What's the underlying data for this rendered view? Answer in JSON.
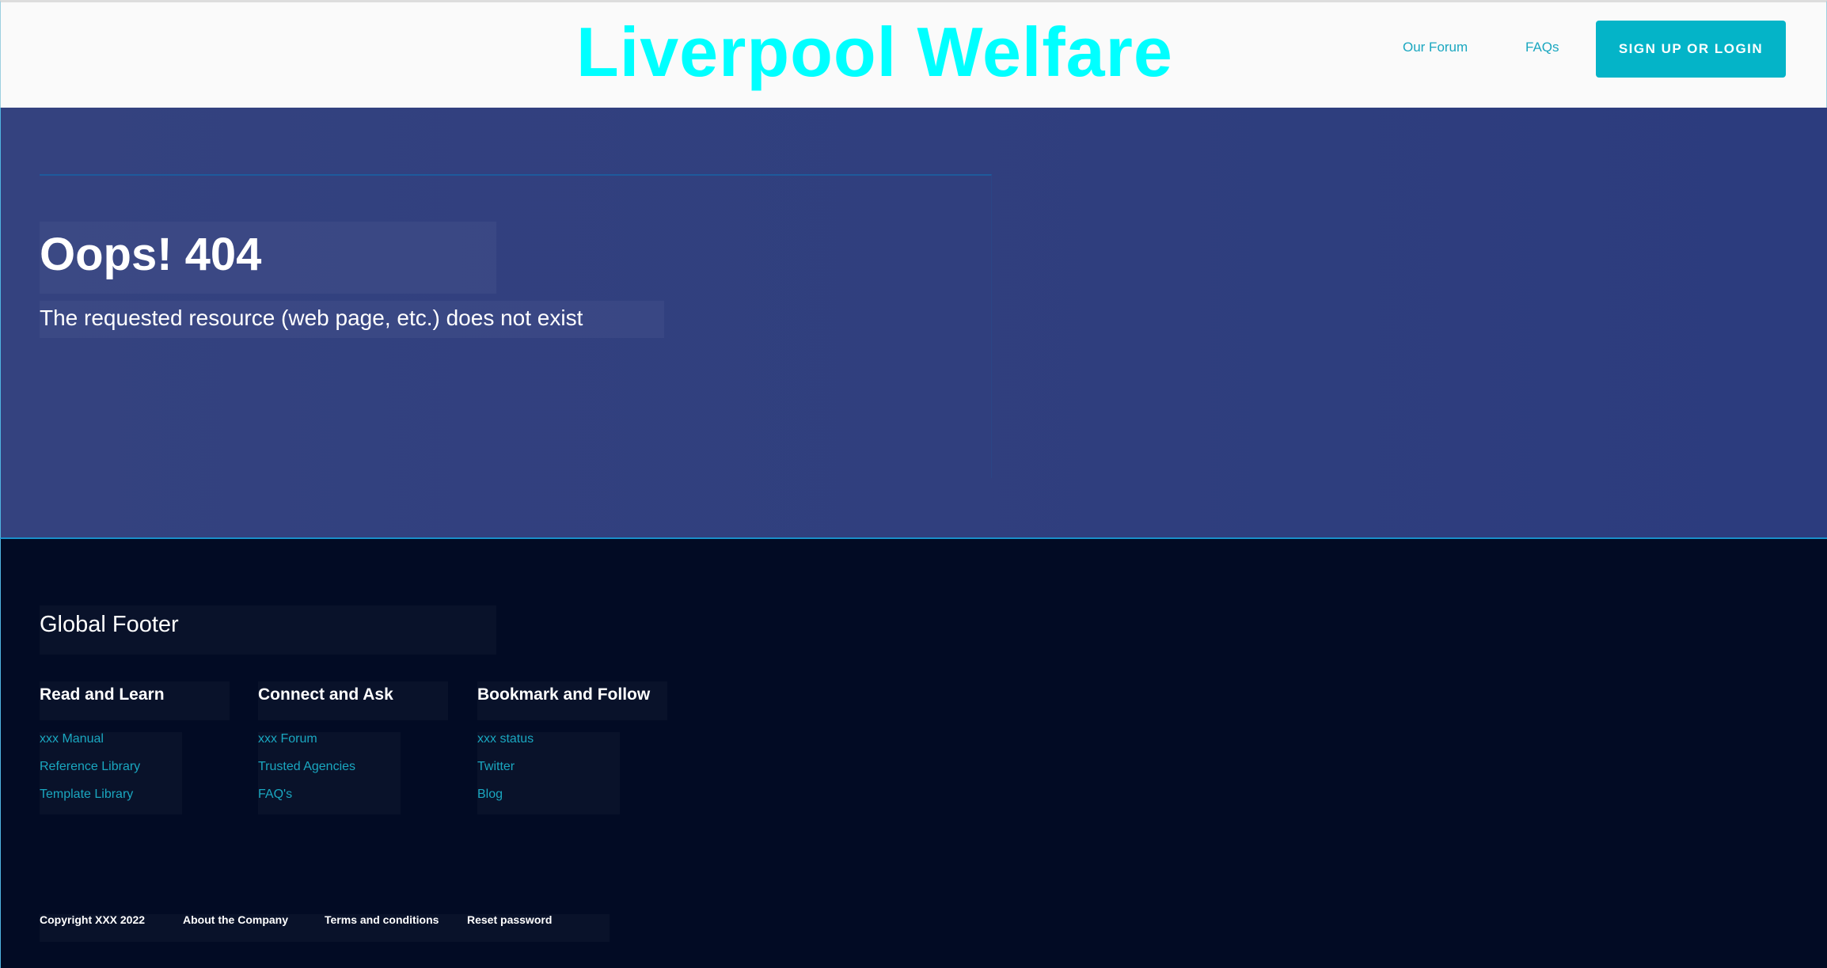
{
  "header": {
    "logo": "Liverpool Welfare",
    "nav": [
      "Our Forum",
      "FAQs"
    ],
    "signup_label": "SIGN UP OR LOGIN"
  },
  "hero": {
    "title": "Oops! 404",
    "subtitle": "The requested resource (web page, etc.) does not exist"
  },
  "footer": {
    "title": "Global Footer",
    "columns": [
      {
        "heading": "Read and Learn",
        "links": [
          "xxx Manual",
          "Reference Library",
          "Template Library"
        ]
      },
      {
        "heading": "Connect and Ask",
        "links": [
          "xxx Forum",
          "Trusted Agencies",
          "FAQ's"
        ]
      },
      {
        "heading": "Bookmark and Follow",
        "links": [
          "xxx status",
          "Twitter",
          "Blog"
        ]
      }
    ],
    "bottom": [
      "Copyright XXX 2022",
      "About the Company",
      "Terms and conditions",
      "Reset password"
    ]
  },
  "colors": {
    "logo": "#00ffff",
    "accent": "#04b4c8",
    "link": "#1aa7c0",
    "hero_bg": "#2f3f7f",
    "footer_bg": "#020b24"
  }
}
